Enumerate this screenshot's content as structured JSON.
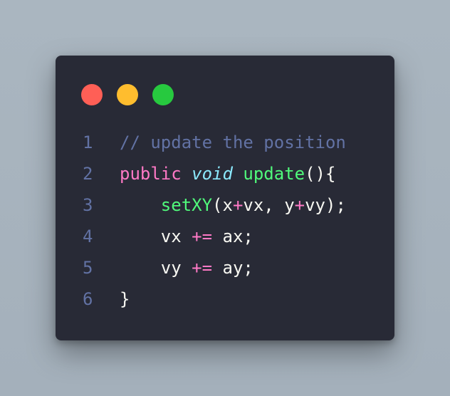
{
  "window": {
    "controls": [
      {
        "name": "close",
        "color": "#ff5f56"
      },
      {
        "name": "minimize",
        "color": "#ffbd2e"
      },
      {
        "name": "maximize",
        "color": "#27c93f"
      }
    ]
  },
  "code": {
    "lines": [
      {
        "number": "1",
        "tokens": [
          {
            "t": "// update the position",
            "k": "comment"
          }
        ]
      },
      {
        "number": "2",
        "tokens": [
          {
            "t": "public",
            "k": "keyword"
          },
          {
            "t": " ",
            "k": "plain"
          },
          {
            "t": "void",
            "k": "type"
          },
          {
            "t": " ",
            "k": "plain"
          },
          {
            "t": "update",
            "k": "func"
          },
          {
            "t": "(){",
            "k": "plain"
          }
        ]
      },
      {
        "number": "3",
        "tokens": [
          {
            "t": "    ",
            "k": "plain"
          },
          {
            "t": "setXY",
            "k": "func"
          },
          {
            "t": "(x",
            "k": "plain"
          },
          {
            "t": "+",
            "k": "op"
          },
          {
            "t": "vx, y",
            "k": "plain"
          },
          {
            "t": "+",
            "k": "op"
          },
          {
            "t": "vy);",
            "k": "plain"
          }
        ]
      },
      {
        "number": "4",
        "tokens": [
          {
            "t": "    vx ",
            "k": "plain"
          },
          {
            "t": "+=",
            "k": "op"
          },
          {
            "t": " ax;",
            "k": "plain"
          }
        ]
      },
      {
        "number": "5",
        "tokens": [
          {
            "t": "    vy ",
            "k": "plain"
          },
          {
            "t": "+=",
            "k": "op"
          },
          {
            "t": " ay;",
            "k": "plain"
          }
        ]
      },
      {
        "number": "6",
        "tokens": [
          {
            "t": "}",
            "k": "plain"
          }
        ]
      }
    ]
  }
}
